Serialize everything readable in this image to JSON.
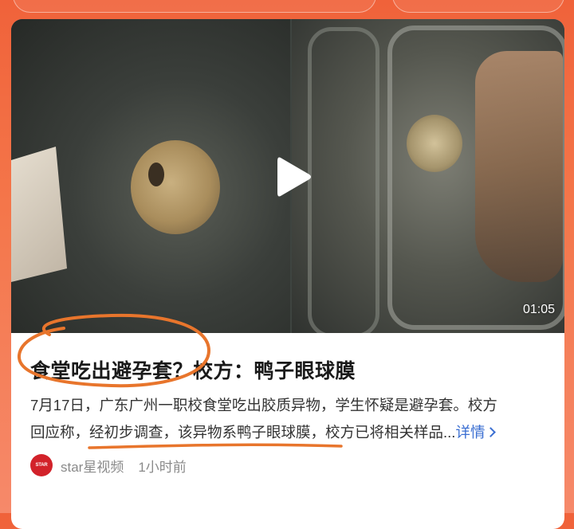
{
  "video": {
    "duration": "01:05",
    "play_icon": "play-icon"
  },
  "article": {
    "title": "食堂吃出避孕套？校方：鸭子眼球膜",
    "description_line1": "7月17日，广东广州一职校食堂吃出胶质异物，学生怀疑是避孕套。校方",
    "description_line2": "回应称，经初步调查，该异物系鸭子眼球膜，校方已将相关样品...",
    "more_label": "详情",
    "more_icon": "chevron-right-icon"
  },
  "meta": {
    "avatar_text": "STAR",
    "source": "star星视频",
    "time": "1小时前"
  },
  "colors": {
    "background": "#f0623a",
    "annotation": "#e8752c",
    "link": "#3b6fd2"
  }
}
